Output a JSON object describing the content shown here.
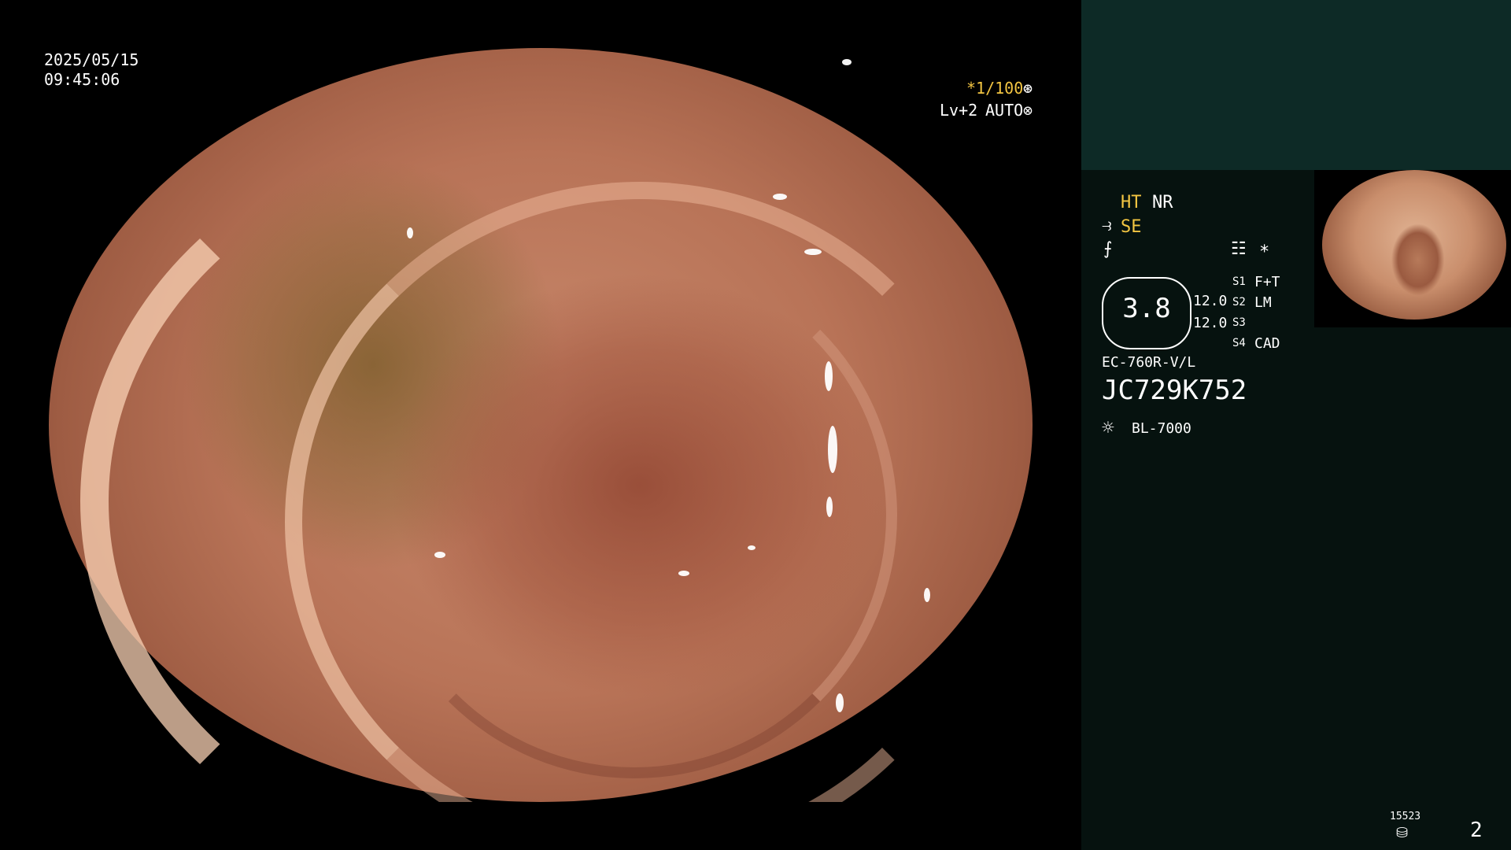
{
  "osd": {
    "date": "2025/05/15",
    "time": "09:45:06",
    "shutter": "*1/100",
    "level": "Lv+2",
    "mode": "AUTO"
  },
  "status": {
    "ht": "HT",
    "nr": "NR",
    "se": "SE",
    "star": "*",
    "s1_label": "S1",
    "s1_value": "F+T",
    "s2_label": "S2",
    "s2_value": "LM",
    "s3_label": "S3",
    "s3_value": "",
    "s4_label": "S4",
    "s4_value": "CAD",
    "main_value": "3.8",
    "sub_value_1": "12.0",
    "sub_value_2": "12.0",
    "scope_model": "EC-760R-V/L",
    "serial": "JC729K752",
    "light_source": "BL-7000",
    "counter": "15523",
    "page": "2"
  },
  "colors": {
    "accent": "#f3c542",
    "panel_top": "#0d2a26",
    "panel": "#06120f"
  },
  "icons": {
    "shutter": "aperture-icon",
    "auto": "iris-icon",
    "structure": "structure-enhance-icon",
    "color": "color-mode-icon",
    "record": "record-list-icon",
    "lamp": "lamp-icon",
    "storage": "storage-icon"
  }
}
